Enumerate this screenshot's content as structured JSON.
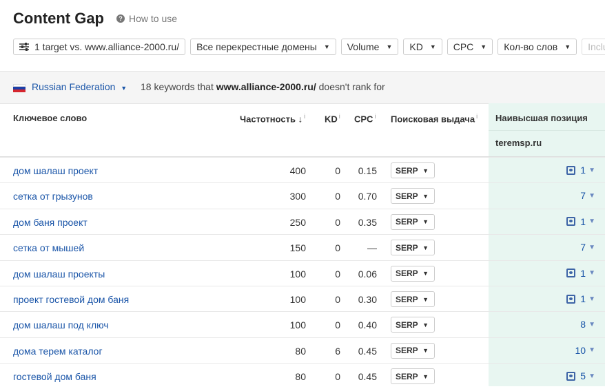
{
  "header": {
    "title": "Content Gap",
    "how_to_use": "How to use"
  },
  "filters": {
    "target": "1 target vs. www.alliance-2000.ru/",
    "domains": "Все перекрестные домены",
    "volume": "Volume",
    "kd": "KD",
    "cpc": "CPC",
    "word_count": "Кол-во слов",
    "include_placeholder": "Includ"
  },
  "infobar": {
    "country": "Russian Federation",
    "summary_prefix": "18 keywords that",
    "summary_domain": "www.alliance-2000.ru/",
    "summary_suffix": "doesn't rank for"
  },
  "table": {
    "columns": {
      "keyword": "Ключевое слово",
      "volume": "Частотность",
      "kd": "KD",
      "cpc": "CPC",
      "serp": "Поисковая выдача",
      "highest_position": "Наивысшая позиция",
      "competitor": "teremsp.ru"
    },
    "serp_label": "SERP",
    "rows": [
      {
        "keyword": "дом шалаш проект",
        "volume": "400",
        "kd": "0",
        "cpc": "0.15",
        "position": "1",
        "has_image": true
      },
      {
        "keyword": "сетка от грызунов",
        "volume": "300",
        "kd": "0",
        "cpc": "0.70",
        "position": "7",
        "has_image": false
      },
      {
        "keyword": "дом баня проект",
        "volume": "250",
        "kd": "0",
        "cpc": "0.35",
        "position": "1",
        "has_image": true
      },
      {
        "keyword": "сетка от мышей",
        "volume": "150",
        "kd": "0",
        "cpc": "—",
        "position": "7",
        "has_image": false
      },
      {
        "keyword": "дом шалаш проекты",
        "volume": "100",
        "kd": "0",
        "cpc": "0.06",
        "position": "1",
        "has_image": true
      },
      {
        "keyword": "проект гостевой дом баня",
        "volume": "100",
        "kd": "0",
        "cpc": "0.30",
        "position": "1",
        "has_image": true
      },
      {
        "keyword": "дом шалаш под ключ",
        "volume": "100",
        "kd": "0",
        "cpc": "0.40",
        "position": "8",
        "has_image": false
      },
      {
        "keyword": "дома терем каталог",
        "volume": "80",
        "kd": "6",
        "cpc": "0.45",
        "position": "10",
        "has_image": false
      },
      {
        "keyword": "гостевой дом баня",
        "volume": "80",
        "kd": "0",
        "cpc": "0.45",
        "position": "5",
        "has_image": true
      }
    ]
  },
  "colors": {
    "link": "#1a55a8",
    "highlight_column": "#e8f6f1",
    "infobar_bg": "#f5f5f5"
  }
}
